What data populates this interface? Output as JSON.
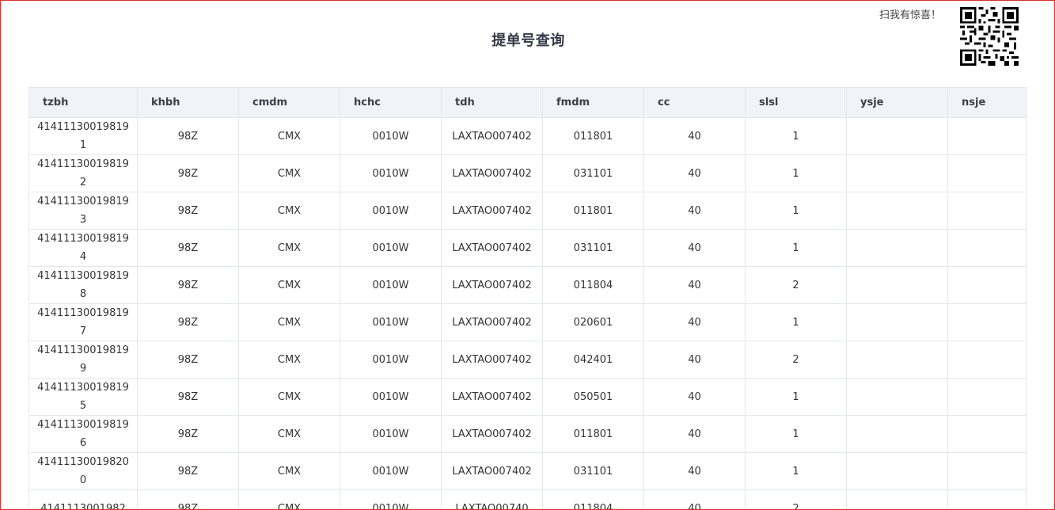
{
  "page": {
    "title": "提单号查询",
    "promo_text": "扫我有惊喜！"
  },
  "table": {
    "columns": [
      "tzbh",
      "khbh",
      "cmdm",
      "hchc",
      "tdh",
      "fmdm",
      "cc",
      "slsl",
      "ysje",
      "nsje"
    ],
    "rows": [
      [
        "414111300198191",
        "98Z",
        "CMX",
        "0010W",
        "LAXTAO007402",
        "011801",
        "40",
        "1",
        "",
        ""
      ],
      [
        "414111300198192",
        "98Z",
        "CMX",
        "0010W",
        "LAXTAO007402",
        "031101",
        "40",
        "1",
        "",
        ""
      ],
      [
        "414111300198193",
        "98Z",
        "CMX",
        "0010W",
        "LAXTAO007402",
        "011801",
        "40",
        "1",
        "",
        ""
      ],
      [
        "414111300198194",
        "98Z",
        "CMX",
        "0010W",
        "LAXTAO007402",
        "031101",
        "40",
        "1",
        "",
        ""
      ],
      [
        "414111300198198",
        "98Z",
        "CMX",
        "0010W",
        "LAXTAO007402",
        "011804",
        "40",
        "2",
        "",
        ""
      ],
      [
        "414111300198197",
        "98Z",
        "CMX",
        "0010W",
        "LAXTAO007402",
        "020601",
        "40",
        "1",
        "",
        ""
      ],
      [
        "414111300198199",
        "98Z",
        "CMX",
        "0010W",
        "LAXTAO007402",
        "042401",
        "40",
        "2",
        "",
        ""
      ],
      [
        "414111300198195",
        "98Z",
        "CMX",
        "0010W",
        "LAXTAO007402",
        "050501",
        "40",
        "1",
        "",
        ""
      ],
      [
        "414111300198196",
        "98Z",
        "CMX",
        "0010W",
        "LAXTAO007402",
        "011801",
        "40",
        "1",
        "",
        ""
      ],
      [
        "414111300198200",
        "98Z",
        "CMX",
        "0010W",
        "LAXTAO007402",
        "031101",
        "40",
        "1",
        "",
        ""
      ],
      [
        "4141113001982",
        "98Z",
        "CMX",
        "0010W",
        "LAXTAO00740",
        "011804",
        "40",
        "2",
        "",
        ""
      ]
    ]
  },
  "colors": {
    "header_bg": "#f0f3f7",
    "border": "#e3e7ec",
    "frame_border": "#d93030"
  },
  "icons": {
    "qr": "qr-code-icon"
  }
}
